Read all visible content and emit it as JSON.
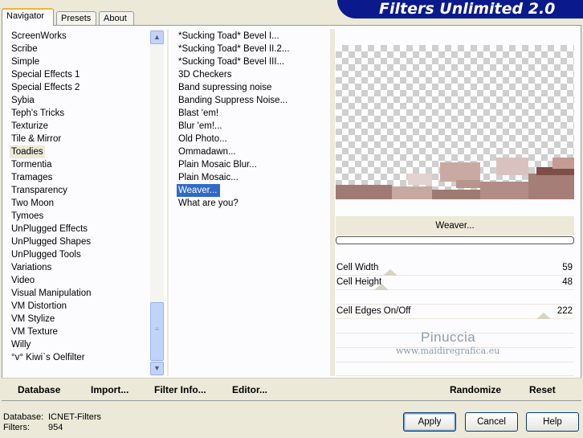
{
  "tabs": [
    {
      "label": "Navigator",
      "active": true
    },
    {
      "label": "Presets",
      "active": false
    },
    {
      "label": "About",
      "active": false
    }
  ],
  "brand_title": "Filters Unlimited 2.0",
  "categories": [
    "ScreenWorks",
    "Scribe",
    "Simple",
    "Special Effects 1",
    "Special Effects 2",
    "Sybia",
    "Teph's Tricks",
    "Texturize",
    "Tile & Mirror",
    "Toadies",
    "Tormentia",
    "Tramages",
    "Transparency",
    "Two Moon",
    "Tymoes",
    "UnPlugged Effects",
    "UnPlugged Shapes",
    "UnPlugged Tools",
    "Variations",
    "Video",
    "Visual Manipulation",
    "VM Distortion",
    "VM Stylize",
    "VM Texture",
    "Willy",
    "°v° Kiwi`s Oelfilter"
  ],
  "selected_category": "Toadies",
  "filters": [
    "*Sucking Toad*  Bevel I...",
    "*Sucking Toad*  Bevel II.2...",
    "*Sucking Toad*  Bevel III...",
    "3D Checkers",
    "Band supressing noise",
    "Banding Suppress Noise...",
    "Blast 'em!",
    "Blur 'em!...",
    "Old Photo...",
    "Ommadawn...",
    "Plain Mosaic Blur...",
    "Plain Mosaic...",
    "Weaver...",
    "What are you?"
  ],
  "selected_filter": "Weaver...",
  "current_filter_name": "Weaver...",
  "params": [
    {
      "label": "Cell Width",
      "value": "59"
    },
    {
      "label": "Cell Height",
      "value": "48"
    },
    {
      "label": "Cell Edges On/Off",
      "value": "222"
    }
  ],
  "watermark": {
    "line1": "Pinuccia",
    "line2": "www.maidiregrafica.eu"
  },
  "bottom_actions": {
    "database": "Database",
    "import": "Import...",
    "filter_info": "Filter Info...",
    "editor": "Editor...",
    "randomize": "Randomize",
    "reset": "Reset"
  },
  "status": {
    "database_label": "Database:",
    "database_value": "ICNET-Filters",
    "filters_label": "Filters:",
    "filters_value": "954"
  },
  "dialog_buttons": {
    "apply": "Apply",
    "cancel": "Cancel",
    "help": "Help"
  },
  "colors": {
    "selection_blue": "#316ac5",
    "brand_navy": "#0a1a8c",
    "background": "#ece9d8"
  }
}
